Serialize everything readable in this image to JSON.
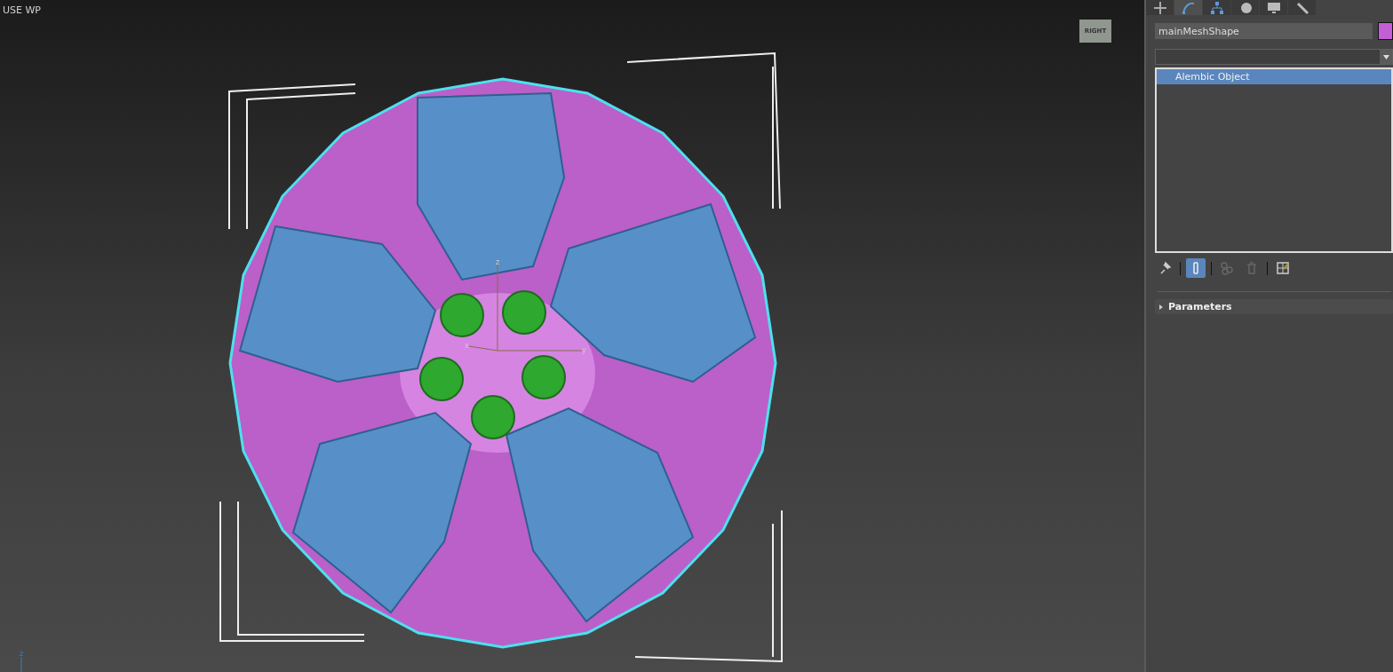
{
  "viewport": {
    "label": "USE WP",
    "viewcube_face": "RIGHT",
    "gizmo_labels": [
      "z",
      "x",
      "y"
    ],
    "corner_axis_label": "z"
  },
  "command_panel": {
    "tabs": [
      {
        "kind": "create",
        "selected": false
      },
      {
        "kind": "modify",
        "selected": true
      },
      {
        "kind": "hierarchy",
        "selected": false
      },
      {
        "kind": "motion",
        "selected": false
      },
      {
        "kind": "display",
        "selected": false
      },
      {
        "kind": "utilities",
        "selected": false
      }
    ],
    "object": {
      "name": "mainMeshShape",
      "color": "#c35fd6"
    },
    "stack": [
      {
        "label": "Alembic Object",
        "selected": true
      }
    ],
    "stack_tools": [
      {
        "kind": "pin",
        "on": false
      },
      {
        "kind": "end-result",
        "on": true
      },
      {
        "kind": "make-unique",
        "on": false
      },
      {
        "kind": "remove",
        "on": false
      },
      {
        "kind": "configure",
        "on": false
      }
    ],
    "rollouts": [
      {
        "title": "Parameters",
        "expanded": false
      }
    ]
  }
}
